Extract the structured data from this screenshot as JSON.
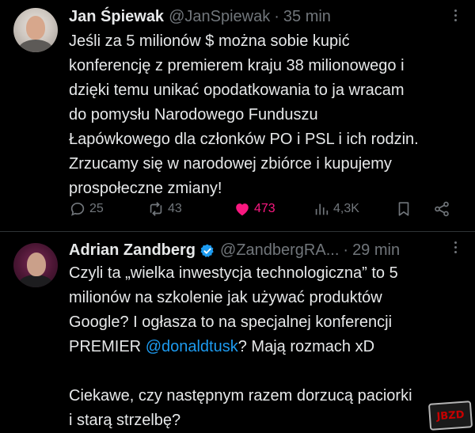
{
  "tweets": [
    {
      "name": "Jan Śpiewak",
      "handle": "@JanSpiewak",
      "separator": "·",
      "time": "35 min",
      "text": "Jeśli za 5 milionów $ można sobie kupić\nkonferencję z premierem kraju 38 milionowego i\ndzięki temu unikać opodatkowania to ja wracam\ndo pomysłu Narodowego Funduszu\nŁapówkowego dla członków PO i PSL i ich rodzin.\nZrzucamy się w narodowej zbiórce i kupujemy\nprospołeczne zmiany!",
      "stats": {
        "replies": "25",
        "reposts": "43",
        "likes": "473",
        "views": "4,3K"
      },
      "liked": true
    },
    {
      "name": "Adrian Zandberg",
      "handle": "@ZandbergRA...",
      "separator": "·",
      "time": "29 min",
      "verified": true,
      "text_before_mention": "Czyli ta „wielka inwestycja technologiczna” to 5\nmilionów na szkolenie jak używać produktów\nGoogle? I ogłasza to na specjalnej konferencji\nPREMIER ",
      "mention": "@donaldtusk",
      "text_after_mention": "? Mają rozmach xD\n\nCiekawe, czy następnym razem dorzucą paciorki\ni starą strzelbę?"
    }
  ],
  "watermark": "JBZD",
  "colors": {
    "background": "#000000",
    "text": "#e7e9ea",
    "muted": "#71767b",
    "like": "#f91880",
    "link": "#1d9bf0",
    "divider": "#2f3336"
  },
  "icons": [
    "more-icon",
    "reply-icon",
    "repost-icon",
    "like-icon",
    "views-icon",
    "bookmark-icon",
    "share-icon",
    "verified-icon"
  ]
}
